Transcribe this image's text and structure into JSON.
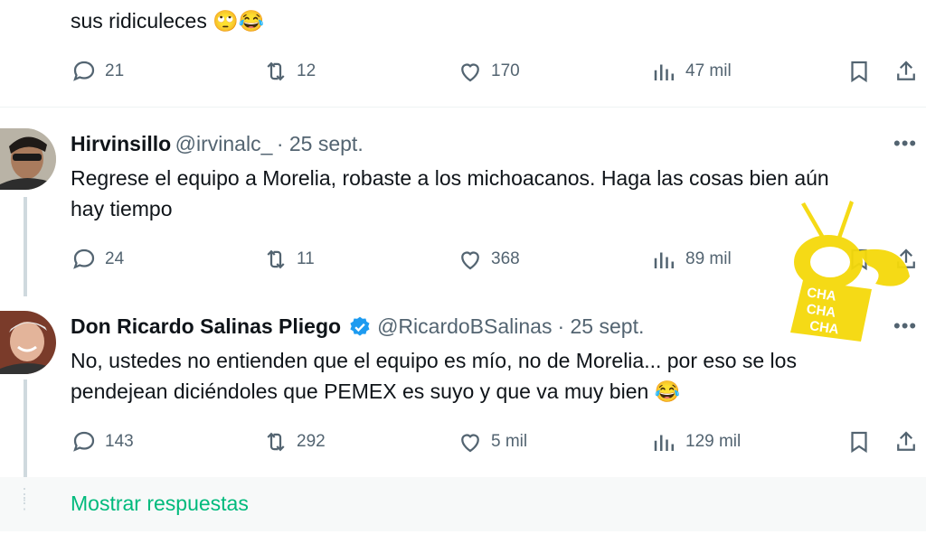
{
  "tweet0": {
    "text": "sus ridiculeces 🙄😂",
    "replies": "21",
    "retweets": "12",
    "likes": "170",
    "views": "47 mil"
  },
  "tweet1": {
    "name": "Hirvinsillo",
    "handle": "@irvinalc_",
    "date": "· 25 sept.",
    "text_line1": "Regrese el equipo a Morelia, robaste a los michoacanos. Haga las cosas bien aún",
    "text_line2": "hay tiempo",
    "replies": "24",
    "retweets": "11",
    "likes": "368",
    "views": "89 mil"
  },
  "tweet2": {
    "name": "Don Ricardo Salinas Pliego",
    "handle": "@RicardoBSalinas",
    "date": "· 25 sept.",
    "text_line1": "No, ustedes no entienden que el equipo es mío, no de Morelia... por eso se los",
    "text_line2": "pendejean diciéndoles que PEMEX es suyo y que va muy bien 😂",
    "replies": "143",
    "retweets": "292",
    "likes": "5 mil",
    "views": "129 mil"
  },
  "show_replies": "Mostrar respuestas",
  "watermark": "CHACHACHA",
  "colors": {
    "accent": "#1d9bf0",
    "green_link": "#00ba7c",
    "watermark": "#f5d90a",
    "muted": "#536471"
  }
}
